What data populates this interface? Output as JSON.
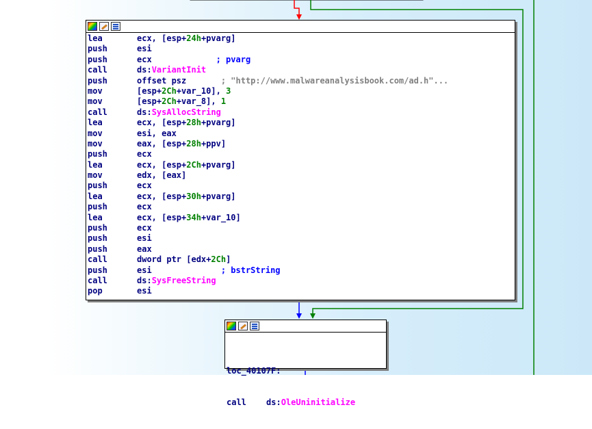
{
  "main_block": {
    "icons": [
      "color-palette-icon",
      "rename-icon",
      "graph-overview-icon"
    ],
    "lines": [
      {
        "mnemonic": "lea",
        "parts": [
          {
            "t": "ecx, [esp+",
            "c": "ops"
          },
          {
            "t": "24h",
            "c": "num"
          },
          {
            "t": "+pvarg]",
            "c": "ops"
          }
        ]
      },
      {
        "mnemonic": "push",
        "parts": [
          {
            "t": "esi",
            "c": "ops"
          }
        ]
      },
      {
        "mnemonic": "push",
        "parts": [
          {
            "t": "ecx             ",
            "c": "ops"
          },
          {
            "t": "; pvarg",
            "c": "cmt"
          }
        ]
      },
      {
        "mnemonic": "call",
        "parts": [
          {
            "t": "ds:",
            "c": "ops"
          },
          {
            "t": "VariantInit",
            "c": "api"
          }
        ]
      },
      {
        "mnemonic": "push",
        "parts": [
          {
            "t": "offset psz       ",
            "c": "ops"
          },
          {
            "t": "; \"http://www.malwareanalysisbook.com/ad.h\"...",
            "c": "str"
          }
        ]
      },
      {
        "mnemonic": "mov",
        "parts": [
          {
            "t": "[esp+",
            "c": "ops"
          },
          {
            "t": "2Ch",
            "c": "num"
          },
          {
            "t": "+var_10], ",
            "c": "ops"
          },
          {
            "t": "3",
            "c": "num"
          }
        ]
      },
      {
        "mnemonic": "mov",
        "parts": [
          {
            "t": "[esp+",
            "c": "ops"
          },
          {
            "t": "2Ch",
            "c": "num"
          },
          {
            "t": "+var_8], ",
            "c": "ops"
          },
          {
            "t": "1",
            "c": "num"
          }
        ]
      },
      {
        "mnemonic": "call",
        "parts": [
          {
            "t": "ds:",
            "c": "ops"
          },
          {
            "t": "SysAllocString",
            "c": "api"
          }
        ]
      },
      {
        "mnemonic": "lea",
        "parts": [
          {
            "t": "ecx, [esp+",
            "c": "ops"
          },
          {
            "t": "28h",
            "c": "num"
          },
          {
            "t": "+pvarg]",
            "c": "ops"
          }
        ]
      },
      {
        "mnemonic": "mov",
        "parts": [
          {
            "t": "esi, eax",
            "c": "ops"
          }
        ]
      },
      {
        "mnemonic": "mov",
        "parts": [
          {
            "t": "eax, [esp+",
            "c": "ops"
          },
          {
            "t": "28h",
            "c": "num"
          },
          {
            "t": "+ppv]",
            "c": "ops"
          }
        ]
      },
      {
        "mnemonic": "push",
        "parts": [
          {
            "t": "ecx",
            "c": "ops"
          }
        ]
      },
      {
        "mnemonic": "lea",
        "parts": [
          {
            "t": "ecx, [esp+",
            "c": "ops"
          },
          {
            "t": "2Ch",
            "c": "num"
          },
          {
            "t": "+pvarg]",
            "c": "ops"
          }
        ]
      },
      {
        "mnemonic": "mov",
        "parts": [
          {
            "t": "edx, [eax]",
            "c": "ops"
          }
        ]
      },
      {
        "mnemonic": "push",
        "parts": [
          {
            "t": "ecx",
            "c": "ops"
          }
        ]
      },
      {
        "mnemonic": "lea",
        "parts": [
          {
            "t": "ecx, [esp+",
            "c": "ops"
          },
          {
            "t": "30h",
            "c": "num"
          },
          {
            "t": "+pvarg]",
            "c": "ops"
          }
        ]
      },
      {
        "mnemonic": "push",
        "parts": [
          {
            "t": "ecx",
            "c": "ops"
          }
        ]
      },
      {
        "mnemonic": "lea",
        "parts": [
          {
            "t": "ecx, [esp+",
            "c": "ops"
          },
          {
            "t": "34h",
            "c": "num"
          },
          {
            "t": "+var_10]",
            "c": "ops"
          }
        ]
      },
      {
        "mnemonic": "push",
        "parts": [
          {
            "t": "ecx",
            "c": "ops"
          }
        ]
      },
      {
        "mnemonic": "push",
        "parts": [
          {
            "t": "esi",
            "c": "ops"
          }
        ]
      },
      {
        "mnemonic": "push",
        "parts": [
          {
            "t": "eax",
            "c": "ops"
          }
        ]
      },
      {
        "mnemonic": "call",
        "parts": [
          {
            "t": "dword ptr [edx+",
            "c": "ops"
          },
          {
            "t": "2Ch",
            "c": "num"
          },
          {
            "t": "]",
            "c": "ops"
          }
        ]
      },
      {
        "mnemonic": "push",
        "parts": [
          {
            "t": "esi              ",
            "c": "ops"
          },
          {
            "t": "; bstrString",
            "c": "cmt"
          }
        ]
      },
      {
        "mnemonic": "call",
        "parts": [
          {
            "t": "ds:",
            "c": "ops"
          },
          {
            "t": "SysFreeString",
            "c": "api"
          }
        ]
      },
      {
        "mnemonic": "pop",
        "parts": [
          {
            "t": "esi",
            "c": "ops"
          }
        ]
      }
    ]
  },
  "exit_block": {
    "icons": [
      "color-palette-icon",
      "rename-icon",
      "graph-overview-icon"
    ],
    "label": "loc_40107F:",
    "call_mnemonic": "call",
    "call_prefix": "ds:",
    "call_target": "OleUninitialize"
  },
  "colors": {
    "mnemonic": "#000080",
    "number": "#008000",
    "api": "#ff00ff",
    "comment": "#0000ff",
    "string_comment": "#808080",
    "edge_true": "#008000",
    "edge_false": "#ff0000",
    "edge_uncond": "#0000ff"
  }
}
